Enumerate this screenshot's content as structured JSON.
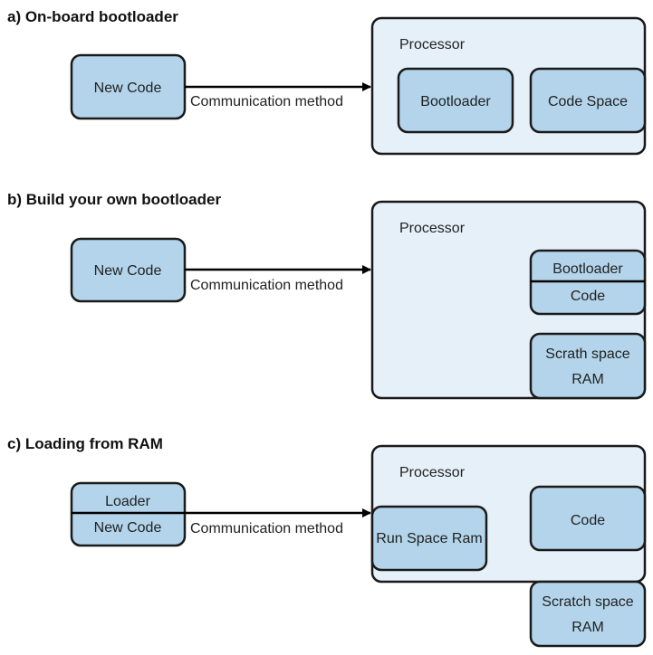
{
  "colors": {
    "processor_fill": "#e6f0f9",
    "block_fill": "#b3d4ea",
    "stroke": "#1a1a1a"
  },
  "panels": {
    "a": {
      "title": "a) On-board bootloader",
      "source": "New Code",
      "arrow_label": "Communication method",
      "processor": "Processor",
      "blocks": [
        "Bootloader",
        "Code Space"
      ]
    },
    "b": {
      "title": "b) Build your own bootloader",
      "source": "New Code",
      "arrow_label": "Communication method",
      "processor": "Processor",
      "stacked": [
        "Bootloader",
        "Code"
      ],
      "scratch": [
        "Scrath space",
        "RAM"
      ]
    },
    "c": {
      "title": "c) Loading from RAM",
      "source_top": "Loader",
      "source_bottom": "New Code",
      "arrow_label": "Communication method",
      "processor": "Processor",
      "run_space": "Run Space Ram",
      "code": "Code",
      "scratch": [
        "Scratch space",
        "RAM"
      ]
    }
  }
}
